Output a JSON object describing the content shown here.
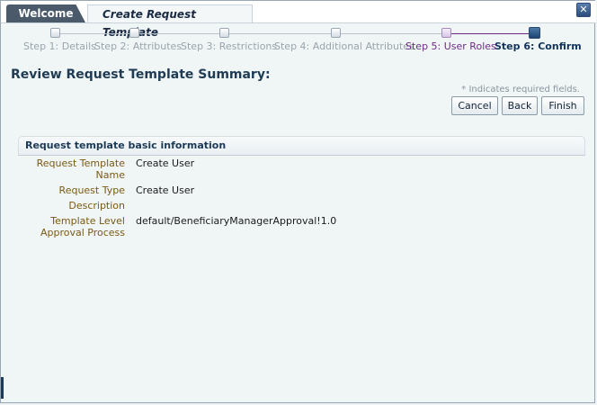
{
  "tabs": {
    "welcome": "Welcome",
    "active": "Create Request Template"
  },
  "close_symbol": "✕",
  "train": {
    "steps": [
      {
        "label": "Step 1: Details",
        "state": "normal"
      },
      {
        "label": "Step 2: Attributes",
        "state": "normal"
      },
      {
        "label": "Step 3: Restrictions",
        "state": "normal"
      },
      {
        "label": "Step 4: Additional Attributes",
        "state": "normal"
      },
      {
        "label": "Step 5: User Roles",
        "state": "visited"
      },
      {
        "label": "Step 6: Confirm",
        "state": "current"
      }
    ]
  },
  "page_title": "Review Request Template Summary:",
  "required_note": "* Indicates required fields.",
  "buttons": {
    "cancel": "Cancel",
    "back": "Back",
    "finish": "Finish"
  },
  "section": {
    "title": "Request template basic information",
    "fields": [
      {
        "label": "Request Template Name",
        "value": "Create User"
      },
      {
        "label": "Request Type",
        "value": "Create User"
      },
      {
        "label": "Description",
        "value": ""
      },
      {
        "label": "Template Level Approval Process",
        "value": "default/BeneficiaryManagerApproval!1.0"
      }
    ]
  },
  "colors": {
    "accent": "#6e2a86",
    "title": "#1f3b54",
    "label": "#7a5a12"
  }
}
